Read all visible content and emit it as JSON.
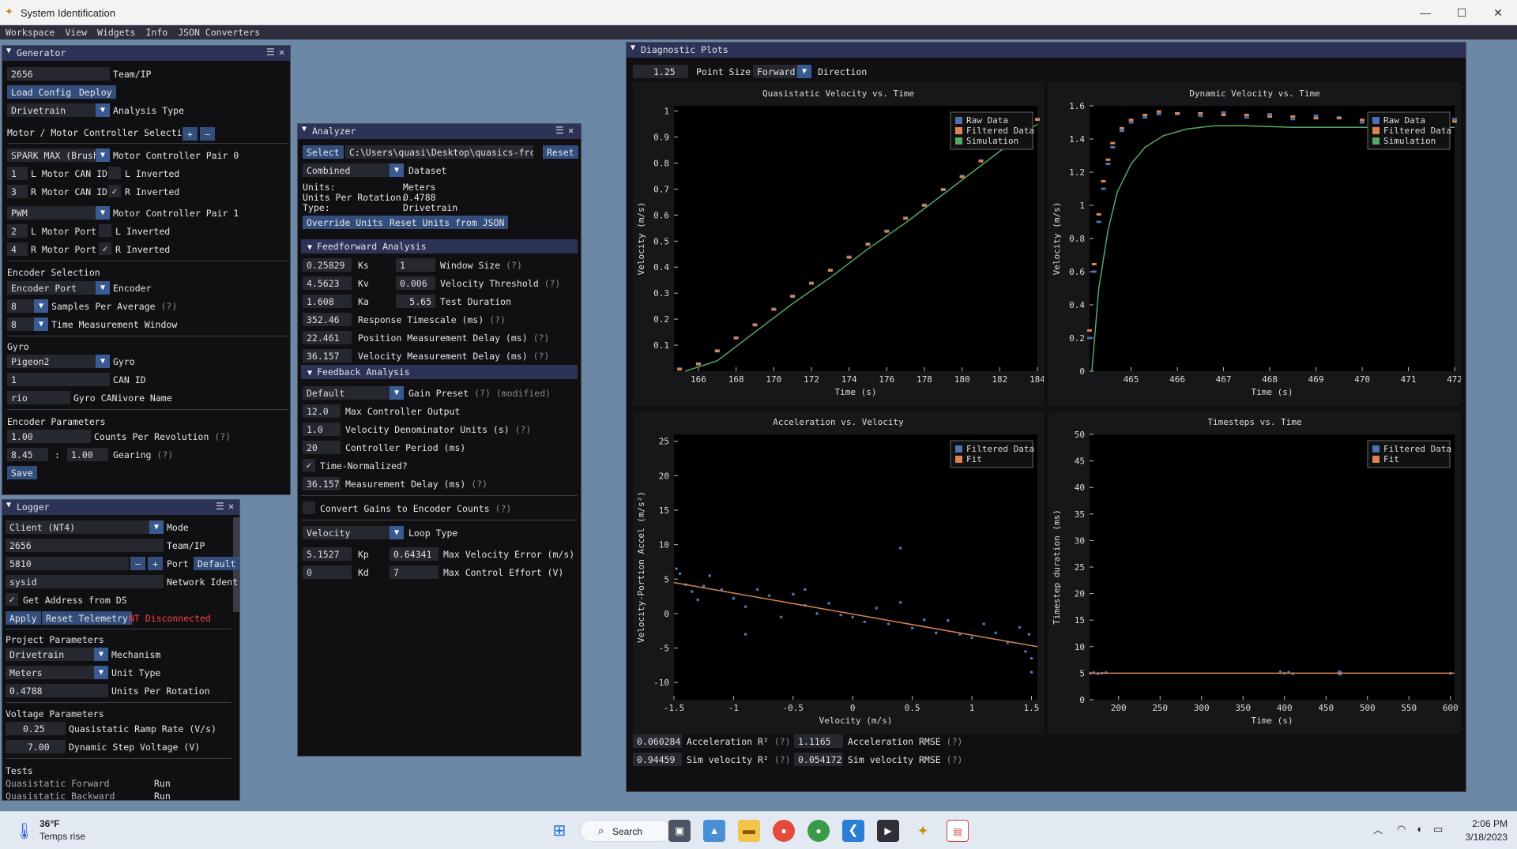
{
  "window": {
    "title": "System Identification",
    "min": "—",
    "max": "☐",
    "close": "✕"
  },
  "menu": [
    "Workspace",
    "View",
    "Widgets",
    "Info",
    "JSON Converters"
  ],
  "generator": {
    "title": "Generator",
    "team": "2656",
    "team_label": "Team/IP",
    "load_config": "Load Config",
    "deploy": "Deploy",
    "analysis_type": "Drivetrain",
    "analysis_type_label": "Analysis Type",
    "motor_section": "Motor / Motor Controller Selection",
    "plus": "+",
    "minus": "–",
    "pair0": "SPARK MAX (Brushl",
    "pair0_label": "Motor Controller Pair 0",
    "l_can": "1",
    "l_can_label": "L Motor CAN ID",
    "l_inv_label": "L Inverted",
    "r_can": "3",
    "r_can_label": "R Motor CAN ID",
    "r_inv_label": "R Inverted",
    "pair1": "PWM",
    "pair1_label": "Motor Controller Pair 1",
    "l_port": "2",
    "l_port_label": "L Motor Port",
    "l_inv2_label": "L Inverted",
    "r_port": "4",
    "r_port_label": "R Motor Port",
    "r_inv2_label": "R Inverted",
    "encoder_section": "Encoder Selection",
    "encoder": "Encoder Port",
    "encoder_label": "Encoder",
    "samples": "8",
    "samples_label": "Samples Per Average",
    "time_window": "8",
    "time_window_label": "Time Measurement Window",
    "gyro_section": "Gyro",
    "gyro": "Pigeon2",
    "gyro_label": "Gyro",
    "can_id": "1",
    "can_id_label": "CAN ID",
    "canivore": "rio",
    "canivore_label": "Gyro CANivore Name",
    "enc_params": "Encoder Parameters",
    "cpr": "1.00",
    "cpr_label": "Counts Per Revolution",
    "gear_a": "8.45",
    "gear_colon": ":",
    "gear_b": "1.00",
    "gear_label": "Gearing",
    "save": "Save",
    "help": "(?)"
  },
  "logger": {
    "title": "Logger",
    "mode": "Client (NT4)",
    "mode_label": "Mode",
    "team": "2656",
    "team_label": "Team/IP",
    "port": "5810",
    "port_minus": "–",
    "port_plus": "+",
    "port_label": "Port",
    "default": "Default",
    "ident": "sysid",
    "ident_label": "Network Ident",
    "get_addr": "Get Address from DS",
    "apply": "Apply",
    "reset": "Reset Telemetry",
    "status": "NT Disconnected",
    "project_params": "Project Parameters",
    "mechanism": "Drivetrain",
    "mechanism_label": "Mechanism",
    "unit_type": "Meters",
    "unit_type_label": "Unit Type",
    "upr": "0.4788",
    "upr_label": "Units Per Rotation",
    "voltage_params": "Voltage Parameters",
    "ramp": "0.25",
    "ramp_label": "Quasistatic Ramp Rate (V/s)",
    "step": "7.00",
    "step_label": "Dynamic Step Voltage (V)",
    "tests": "Tests",
    "test1": "Quasistatic Forward",
    "test1_btn": "Run",
    "test2": "Quasistatic Backward",
    "test2_btn": "Run"
  },
  "analyzer": {
    "title": "Analyzer",
    "select": "Select",
    "path": "C:\\Users\\quasi\\Desktop\\quasics-frc-sw-",
    "reset": "Reset",
    "dataset": "Combined",
    "dataset_label": "Dataset",
    "units_k": "Units:",
    "units_v": "Meters",
    "upr_k": "Units Per Rotation:",
    "upr_v": "0.4788",
    "type_k": "Type:",
    "type_v": "Drivetrain",
    "override": "Override Units",
    "reset_units": "Reset Units from JSON",
    "ff_header": "Feedforward Analysis",
    "ks": "0.25829",
    "ks_label": "Ks",
    "kv": "4.5623",
    "kv_label": "Kv",
    "ka": "1.608",
    "ka_label": "Ka",
    "resp": "352.46",
    "resp_label": "Response Timescale (ms)",
    "pos_delay": "22.461",
    "pos_delay_label": "Position Measurement Delay (ms)",
    "vel_delay": "36.157",
    "vel_delay_label": "Velocity Measurement Delay (ms)",
    "window": "1",
    "window_label": "Window Size",
    "vthresh": "0.006",
    "vthresh_label": "Velocity Threshold",
    "duration": "5.65",
    "duration_label": "Test Duration",
    "fb_header": "Feedback Analysis",
    "preset": "Default",
    "preset_label": "Gain Preset",
    "modified": "(modified)",
    "max_out": "12.0",
    "max_out_label": "Max Controller Output",
    "vel_denom": "1.0",
    "vel_denom_label": "Velocity Denominator Units (s)",
    "period": "20",
    "period_label": "Controller Period (ms)",
    "time_norm": "Time-Normalized?",
    "meas_delay": "36.157",
    "meas_delay_label": "Measurement Delay (ms)",
    "convert": "Convert Gains to Encoder Counts",
    "loop": "Velocity",
    "loop_label": "Loop Type",
    "kp": "5.1527",
    "kp_label": "Kp",
    "kd": "0",
    "kd_label": "Kd",
    "max_vel_err": "0.64341",
    "max_vel_err_label": "Max Velocity Error (m/s)",
    "max_effort": "7",
    "max_effort_label": "Max Control Effort (V)",
    "help": "(?)"
  },
  "diag": {
    "title": "Diagnostic Plots",
    "point_size": "1.25",
    "point_size_label": "Point Size",
    "direction": "Forward",
    "direction_label": "Direction",
    "acc_r2": "0.060284",
    "acc_r2_label": "Acceleration R²",
    "acc_rmse": "1.1165",
    "acc_rmse_label": "Acceleration RMSE",
    "sim_r2": "0.94459",
    "sim_r2_label": "Sim velocity R²",
    "sim_rmse": "0.054172",
    "sim_rmse_label": "Sim velocity RMSE",
    "help": "(?)"
  },
  "chart_data": [
    {
      "type": "scatter",
      "title": "Quasistatic Velocity vs. Time",
      "xlabel": "Time (s)",
      "ylabel": "Velocity (m/s)",
      "xlim": [
        164.7,
        184
      ],
      "ylim": [
        0,
        1.02
      ],
      "xticks": [
        166,
        168,
        170,
        172,
        174,
        176,
        178,
        180,
        182,
        184
      ],
      "yticks": [
        0.1,
        0.2,
        0.3,
        0.4,
        0.5,
        0.6,
        0.7,
        0.8,
        0.9,
        1
      ],
      "legend": [
        "Raw Data",
        "Filtered Data",
        "Simulation"
      ],
      "legend_position": "top-right",
      "series": [
        {
          "name": "Raw Data",
          "color": "#4c72b0",
          "x": [
            165,
            166,
            167,
            168,
            169,
            170,
            171,
            172,
            173,
            174,
            175,
            176,
            177,
            178,
            179,
            180,
            181,
            182,
            183,
            184
          ],
          "y": [
            0.01,
            0.03,
            0.08,
            0.13,
            0.18,
            0.24,
            0.29,
            0.34,
            0.39,
            0.44,
            0.49,
            0.54,
            0.59,
            0.64,
            0.7,
            0.75,
            0.81,
            0.86,
            0.91,
            0.97
          ]
        },
        {
          "name": "Filtered Data",
          "color": "#dd8452",
          "x": [
            165,
            166,
            167,
            168,
            169,
            170,
            171,
            172,
            173,
            174,
            175,
            176,
            177,
            178,
            179,
            180,
            181,
            182,
            183,
            184
          ],
          "y": [
            0.01,
            0.03,
            0.08,
            0.13,
            0.18,
            0.24,
            0.29,
            0.34,
            0.39,
            0.44,
            0.49,
            0.54,
            0.59,
            0.64,
            0.7,
            0.75,
            0.81,
            0.86,
            0.91,
            0.97
          ]
        },
        {
          "name": "Simulation",
          "color": "#55a868",
          "x": [
            165.3,
            167,
            169,
            171,
            173,
            175,
            177,
            179,
            181,
            183,
            184
          ],
          "y": [
            0.0,
            0.04,
            0.15,
            0.26,
            0.36,
            0.47,
            0.57,
            0.68,
            0.79,
            0.9,
            0.95
          ]
        }
      ]
    },
    {
      "type": "scatter",
      "title": "Dynamic Velocity vs. Time",
      "xlabel": "Time (s)",
      "ylabel": "Velocity (m/s)",
      "xlim": [
        464.1,
        472
      ],
      "ylim": [
        0,
        1.6
      ],
      "xticks": [
        465,
        466,
        467,
        468,
        469,
        470,
        471,
        472
      ],
      "yticks": [
        0,
        0.2,
        0.4,
        0.6,
        0.8,
        1,
        1.2,
        1.4,
        1.6
      ],
      "legend": [
        "Raw Data",
        "Filtered Data",
        "Simulation"
      ],
      "legend_position": "top-right",
      "series": [
        {
          "name": "Raw Data",
          "color": "#4c72b0",
          "x": [
            464.1,
            464.2,
            464.3,
            464.4,
            464.5,
            464.6,
            464.8,
            465,
            465.3,
            465.6,
            466,
            466.5,
            467,
            467.5,
            468,
            468.5,
            469,
            469.5,
            470,
            470.5,
            471,
            471.5,
            472
          ],
          "y": [
            0.2,
            0.6,
            0.9,
            1.1,
            1.25,
            1.35,
            1.45,
            1.5,
            1.53,
            1.55,
            1.55,
            1.54,
            1.56,
            1.53,
            1.55,
            1.52,
            1.54,
            1.53,
            1.5,
            1.53,
            1.52,
            1.5,
            1.52
          ]
        },
        {
          "name": "Filtered Data",
          "color": "#dd8452",
          "x": [
            464.1,
            464.2,
            464.3,
            464.4,
            464.5,
            464.6,
            464.8,
            465,
            465.3,
            465.6,
            466,
            466.5,
            467,
            467.5,
            468,
            468.5,
            469,
            469.5,
            470,
            470.5,
            471,
            471.5,
            472
          ],
          "y": [
            0.25,
            0.65,
            0.95,
            1.15,
            1.28,
            1.38,
            1.47,
            1.52,
            1.55,
            1.57,
            1.56,
            1.56,
            1.55,
            1.55,
            1.54,
            1.54,
            1.53,
            1.53,
            1.52,
            1.52,
            1.51,
            1.51,
            1.51
          ]
        },
        {
          "name": "Simulation",
          "color": "#55a868",
          "x": [
            464.15,
            464.3,
            464.5,
            464.7,
            465,
            465.3,
            465.7,
            466.2,
            466.8,
            467.5,
            468.5,
            469.5,
            470.5,
            471.5,
            472
          ],
          "y": [
            0,
            0.5,
            0.85,
            1.08,
            1.25,
            1.35,
            1.42,
            1.46,
            1.48,
            1.48,
            1.47,
            1.47,
            1.47,
            1.47,
            1.47
          ]
        }
      ]
    },
    {
      "type": "scatter",
      "title": "Acceleration vs. Velocity",
      "xlabel": "Velocity (m/s)",
      "ylabel": "Velocity-Portion Accel (m/s²)",
      "xlim": [
        -1.5,
        1.55
      ],
      "ylim": [
        -12.5,
        26
      ],
      "xticks": [
        -1.5,
        -1,
        -0.5,
        0,
        0.5,
        1,
        1.5
      ],
      "yticks": [
        -10,
        -5,
        0,
        5,
        10,
        15,
        20,
        25
      ],
      "legend": [
        "Filtered Data",
        "Fit"
      ],
      "legend_position": "top-right",
      "series": [
        {
          "name": "Filtered Data",
          "color": "#4c72b0",
          "x": [
            -1.48,
            -1.45,
            -1.4,
            -1.35,
            -1.3,
            -1.25,
            -1.2,
            -1.1,
            -1.0,
            -0.9,
            -0.8,
            -0.7,
            -0.6,
            -0.5,
            -0.4,
            -0.3,
            -0.2,
            -0.1,
            0.0,
            0.1,
            0.2,
            0.3,
            0.4,
            0.5,
            0.6,
            0.7,
            0.8,
            0.9,
            1.0,
            1.1,
            1.2,
            1.3,
            1.4,
            1.45,
            1.5,
            1.5,
            1.48,
            0.4,
            -0.9,
            -0.4
          ],
          "y": [
            6.5,
            5.8,
            4.2,
            3.2,
            2.0,
            4.0,
            5.5,
            3.5,
            2.2,
            1.0,
            3.5,
            2.6,
            -0.5,
            2.8,
            1.2,
            0.0,
            1.5,
            -0.2,
            -0.5,
            -1.2,
            0.8,
            -1.5,
            1.6,
            -2.1,
            -0.9,
            -2.8,
            -1.0,
            -3.0,
            -3.5,
            -1.5,
            -2.8,
            -4.2,
            -2.0,
            -5.5,
            -6.5,
            -8.5,
            -3.0,
            9.5,
            -3.0,
            3.5
          ]
        },
        {
          "name": "Fit",
          "color": "#dd8452",
          "x": [
            -1.5,
            1.55
          ],
          "y": [
            4.5,
            -4.8
          ]
        }
      ]
    },
    {
      "type": "scatter",
      "title": "Timesteps vs. Time",
      "xlabel": "Time (s)",
      "ylabel": "Timestep duration (ms)",
      "xlim": [
        165,
        605
      ],
      "ylim": [
        0,
        50
      ],
      "xticks": [
        200,
        250,
        300,
        350,
        400,
        450,
        500,
        550,
        600
      ],
      "yticks": [
        0,
        5,
        10,
        15,
        20,
        25,
        30,
        35,
        40,
        45,
        50
      ],
      "legend": [
        "Filtered Data",
        "Fit"
      ],
      "legend_position": "top-right",
      "series": [
        {
          "name": "Filtered Data",
          "color": "#4c72b0",
          "x": [
            166,
            170,
            175,
            180,
            185,
            395,
            400,
            405,
            410,
            465,
            466,
            467,
            468,
            600
          ],
          "y": [
            5.0,
            5.1,
            4.9,
            5.0,
            5.1,
            5.3,
            5.0,
            5.2,
            4.9,
            5.0,
            5.3,
            4.8,
            5.1,
            5.0
          ]
        },
        {
          "name": "Fit",
          "color": "#dd8452",
          "x": [
            165,
            605
          ],
          "y": [
            5.0,
            5.0
          ]
        }
      ]
    }
  ],
  "taskbar": {
    "weather_temp": "36°F",
    "weather_desc": "Temps rise",
    "search": "Search",
    "time": "2:06 PM",
    "date": "3/18/2023"
  }
}
